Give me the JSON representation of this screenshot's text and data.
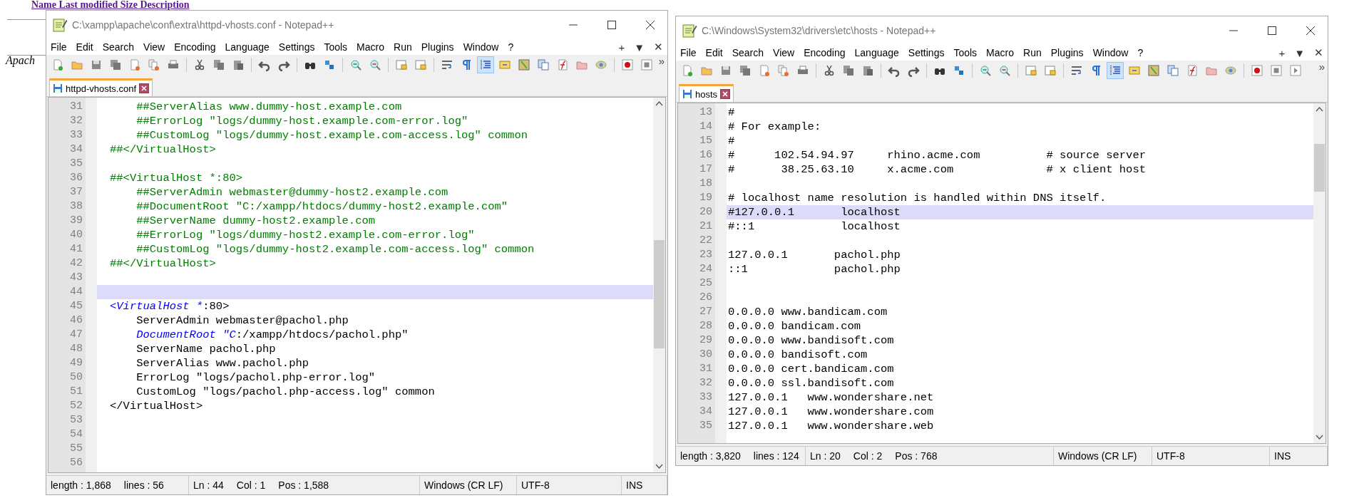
{
  "background_page": {
    "link": "Name Last modified Size Description",
    "footer": "Apach"
  },
  "windows": [
    {
      "title": "C:\\xampp\\apache\\conf\\extra\\httpd-vhosts.conf - Notepad++",
      "menu": [
        "File",
        "Edit",
        "Search",
        "View",
        "Encoding",
        "Language",
        "Settings",
        "Tools",
        "Macro",
        "Run",
        "Plugins",
        "Window",
        "?"
      ],
      "menu_controls": [
        "+",
        "▼",
        "✕"
      ],
      "toolbar": [
        {
          "kind": "new",
          "pressed": false
        },
        {
          "kind": "open",
          "pressed": false
        },
        {
          "kind": "save",
          "pressed": false
        },
        {
          "kind": "saveall",
          "pressed": false
        },
        {
          "kind": "close",
          "pressed": false
        },
        {
          "kind": "closeall",
          "pressed": false
        },
        {
          "kind": "print",
          "pressed": false
        },
        {
          "kind": "separator"
        },
        {
          "kind": "cut",
          "pressed": false
        },
        {
          "kind": "copy",
          "pressed": false
        },
        {
          "kind": "paste",
          "pressed": false
        },
        {
          "kind": "separator"
        },
        {
          "kind": "undo",
          "pressed": false
        },
        {
          "kind": "redo",
          "pressed": false
        },
        {
          "kind": "separator"
        },
        {
          "kind": "find",
          "pressed": false
        },
        {
          "kind": "replace",
          "pressed": false
        },
        {
          "kind": "separator"
        },
        {
          "kind": "zoomin",
          "pressed": false
        },
        {
          "kind": "zoomout",
          "pressed": false
        },
        {
          "kind": "separator"
        },
        {
          "kind": "syncv",
          "pressed": false
        },
        {
          "kind": "synch",
          "pressed": false
        },
        {
          "kind": "separator"
        },
        {
          "kind": "wrap",
          "pressed": false
        },
        {
          "kind": "allchars",
          "pressed": false
        },
        {
          "kind": "indent",
          "pressed": true
        },
        {
          "kind": "udl",
          "pressed": false
        },
        {
          "kind": "docmap",
          "pressed": false
        },
        {
          "kind": "doclist",
          "pressed": false
        },
        {
          "kind": "funclist",
          "pressed": false
        },
        {
          "kind": "folder",
          "pressed": false
        },
        {
          "kind": "monitor",
          "pressed": false
        },
        {
          "kind": "separator"
        },
        {
          "kind": "record",
          "pressed": false
        },
        {
          "kind": "stop",
          "pressed": false
        }
      ],
      "toolbar_overflow": "»",
      "tabs": [
        {
          "label": "httpd-vhosts.conf",
          "selected": true
        }
      ],
      "editor": {
        "lines": [
          {
            "number": "31",
            "selected": false,
            "segments": [
              {
                "text": "    ##ServerAlias www.dummy-host.example.com",
                "kind": "comment"
              }
            ]
          },
          {
            "number": "32",
            "selected": false,
            "segments": [
              {
                "text": "    ##ErrorLog \"logs/dummy-host.example.com-error.log\"",
                "kind": "comment"
              }
            ]
          },
          {
            "number": "33",
            "selected": false,
            "segments": [
              {
                "text": "    ##CustomLog \"logs/dummy-host.example.com-access.log\" common",
                "kind": "comment"
              }
            ]
          },
          {
            "number": "34",
            "selected": false,
            "segments": [
              {
                "text": "##</VirtualHost>",
                "kind": "comment"
              }
            ]
          },
          {
            "number": "35",
            "selected": false
          },
          {
            "number": "36",
            "selected": false,
            "segments": [
              {
                "text": "##<VirtualHost *:80>",
                "kind": "comment"
              }
            ]
          },
          {
            "number": "37",
            "selected": false,
            "segments": [
              {
                "text": "    ##ServerAdmin webmaster@dummy-host2.example.com",
                "kind": "comment"
              }
            ]
          },
          {
            "number": "38",
            "selected": false,
            "segments": [
              {
                "text": "    ##DocumentRoot \"C:/xampp/htdocs/dummy-host2.example.com\"",
                "kind": "comment"
              }
            ]
          },
          {
            "number": "39",
            "selected": false,
            "segments": [
              {
                "text": "    ##ServerName dummy-host2.example.com",
                "kind": "comment"
              }
            ]
          },
          {
            "number": "40",
            "selected": false,
            "segments": [
              {
                "text": "    ##ErrorLog \"logs/dummy-host2.example.com-error.log\"",
                "kind": "comment"
              }
            ]
          },
          {
            "number": "41",
            "selected": false,
            "segments": [
              {
                "text": "    ##CustomLog \"logs/dummy-host2.example.com-access.log\" common",
                "kind": "comment"
              }
            ]
          },
          {
            "number": "42",
            "selected": false,
            "segments": [
              {
                "text": "##</VirtualHost>",
                "kind": "comment"
              }
            ]
          },
          {
            "number": "43",
            "selected": false
          },
          {
            "number": "44",
            "selected": true
          },
          {
            "number": "45",
            "selected": false,
            "segments": [
              {
                "text": "<VirtualHost *",
                "kind": "keyword"
              },
              {
                "text": ":80>",
                "kind": "plain"
              }
            ]
          },
          {
            "number": "46",
            "selected": false,
            "segments": [
              {
                "text": "    ServerAdmin webmaster@pachol.php",
                "kind": "plain"
              }
            ]
          },
          {
            "number": "47",
            "selected": false,
            "segments": [
              {
                "text": "    DocumentRoot \"C",
                "kind": "keyword"
              },
              {
                "text": ":/xampp/htdocs/pachol.php\"",
                "kind": "plain"
              }
            ]
          },
          {
            "number": "48",
            "selected": false,
            "segments": [
              {
                "text": "    ServerName pachol.php",
                "kind": "plain"
              }
            ]
          },
          {
            "number": "49",
            "selected": false,
            "segments": [
              {
                "text": "    ServerAlias www.pachol.php",
                "kind": "plain"
              }
            ]
          },
          {
            "number": "50",
            "selected": false,
            "segments": [
              {
                "text": "    ErrorLog \"logs/pachol.php-error.log\"",
                "kind": "plain"
              }
            ]
          },
          {
            "number": "51",
            "selected": false,
            "segments": [
              {
                "text": "    CustomLog \"logs/pachol.php-access.log\" common",
                "kind": "plain"
              }
            ]
          },
          {
            "number": "52",
            "selected": false,
            "segments": [
              {
                "text": "</VirtualHost>",
                "kind": "plain"
              }
            ]
          },
          {
            "number": "53",
            "selected": false
          },
          {
            "number": "54",
            "selected": false
          },
          {
            "number": "55",
            "selected": false
          },
          {
            "number": "56",
            "selected": false
          }
        ]
      },
      "status_bar": [
        [
          "length : 1,868",
          "lines : 56"
        ],
        [
          "Ln : 44",
          "Col : 1",
          "Pos : 1,588"
        ],
        [
          "Windows (CR LF)"
        ],
        [
          "UTF-8"
        ],
        [
          "INS"
        ]
      ]
    },
    {
      "title": "C:\\Windows\\System32\\drivers\\etc\\hosts - Notepad++",
      "menu": [
        "File",
        "Edit",
        "Search",
        "View",
        "Encoding",
        "Language",
        "Settings",
        "Tools",
        "Macro",
        "Run",
        "Plugins",
        "Window",
        "?"
      ],
      "menu_controls": [
        "+",
        "▼",
        "✕"
      ],
      "toolbar": [
        {
          "kind": "new",
          "pressed": false
        },
        {
          "kind": "open",
          "pressed": false
        },
        {
          "kind": "save",
          "pressed": false
        },
        {
          "kind": "saveall",
          "pressed": false
        },
        {
          "kind": "close",
          "pressed": false
        },
        {
          "kind": "closeall",
          "pressed": false
        },
        {
          "kind": "print",
          "pressed": false
        },
        {
          "kind": "separator"
        },
        {
          "kind": "cut",
          "pressed": false
        },
        {
          "kind": "copy",
          "pressed": false
        },
        {
          "kind": "paste",
          "pressed": false
        },
        {
          "kind": "separator"
        },
        {
          "kind": "undo",
          "pressed": false
        },
        {
          "kind": "redo",
          "pressed": false
        },
        {
          "kind": "separator"
        },
        {
          "kind": "find",
          "pressed": false
        },
        {
          "kind": "replace",
          "pressed": false
        },
        {
          "kind": "separator"
        },
        {
          "kind": "zoomin",
          "pressed": false
        },
        {
          "kind": "zoomout",
          "pressed": false
        },
        {
          "kind": "separator"
        },
        {
          "kind": "syncv",
          "pressed": false
        },
        {
          "kind": "synch",
          "pressed": false
        },
        {
          "kind": "separator"
        },
        {
          "kind": "wrap",
          "pressed": false
        },
        {
          "kind": "allchars",
          "pressed": false
        },
        {
          "kind": "indent",
          "pressed": true
        },
        {
          "kind": "udl",
          "pressed": false
        },
        {
          "kind": "docmap",
          "pressed": false
        },
        {
          "kind": "doclist",
          "pressed": false
        },
        {
          "kind": "funclist",
          "pressed": false
        },
        {
          "kind": "folder",
          "pressed": false
        },
        {
          "kind": "monitor",
          "pressed": false
        },
        {
          "kind": "separator"
        },
        {
          "kind": "record",
          "pressed": false
        },
        {
          "kind": "stop",
          "pressed": false
        },
        {
          "kind": "play",
          "pressed": false
        }
      ],
      "toolbar_overflow": "»",
      "tabs": [
        {
          "label": "hosts",
          "selected": true
        }
      ],
      "editor": {
        "lines": [
          {
            "number": "13",
            "selected": false,
            "segments": [
              {
                "text": "#",
                "kind": "plain"
              }
            ]
          },
          {
            "number": "14",
            "selected": false,
            "segments": [
              {
                "text": "# For example:",
                "kind": "plain"
              }
            ]
          },
          {
            "number": "15",
            "selected": false,
            "segments": [
              {
                "text": "#",
                "kind": "plain"
              }
            ]
          },
          {
            "number": "16",
            "selected": false,
            "segments": [
              {
                "text": "#      102.54.94.97     rhino.acme.com          # source server",
                "kind": "plain"
              }
            ]
          },
          {
            "number": "17",
            "selected": false,
            "segments": [
              {
                "text": "#       38.25.63.10     x.acme.com              # x client host",
                "kind": "plain"
              }
            ]
          },
          {
            "number": "18",
            "selected": false
          },
          {
            "number": "19",
            "selected": false,
            "segments": [
              {
                "text": "# localhost name resolution is handled within DNS itself.",
                "kind": "plain"
              }
            ]
          },
          {
            "number": "20",
            "selected": true,
            "segments": [
              {
                "text": "#127.0.0.1       localhost",
                "kind": "plain"
              }
            ]
          },
          {
            "number": "21",
            "selected": false,
            "segments": [
              {
                "text": "#::1             localhost",
                "kind": "plain"
              }
            ]
          },
          {
            "number": "22",
            "selected": false
          },
          {
            "number": "23",
            "selected": false,
            "segments": [
              {
                "text": "127.0.0.1       pachol.php",
                "kind": "plain"
              }
            ]
          },
          {
            "number": "24",
            "selected": false,
            "segments": [
              {
                "text": "::1             pachol.php",
                "kind": "plain"
              }
            ]
          },
          {
            "number": "25",
            "selected": false
          },
          {
            "number": "26",
            "selected": false
          },
          {
            "number": "27",
            "selected": false,
            "segments": [
              {
                "text": "0.0.0.0 www.bandicam.com",
                "kind": "plain"
              }
            ]
          },
          {
            "number": "28",
            "selected": false,
            "segments": [
              {
                "text": "0.0.0.0 bandicam.com",
                "kind": "plain"
              }
            ]
          },
          {
            "number": "29",
            "selected": false,
            "segments": [
              {
                "text": "0.0.0.0 www.bandisoft.com",
                "kind": "plain"
              }
            ]
          },
          {
            "number": "30",
            "selected": false,
            "segments": [
              {
                "text": "0.0.0.0 bandisoft.com",
                "kind": "plain"
              }
            ]
          },
          {
            "number": "31",
            "selected": false,
            "segments": [
              {
                "text": "0.0.0.0 cert.bandicam.com",
                "kind": "plain"
              }
            ]
          },
          {
            "number": "32",
            "selected": false,
            "segments": [
              {
                "text": "0.0.0.0 ssl.bandisoft.com",
                "kind": "plain"
              }
            ]
          },
          {
            "number": "33",
            "selected": false,
            "segments": [
              {
                "text": "127.0.0.1   www.wondershare.net",
                "kind": "plain"
              }
            ]
          },
          {
            "number": "34",
            "selected": false,
            "segments": [
              {
                "text": "127.0.0.1   www.wondershare.com",
                "kind": "plain"
              }
            ]
          },
          {
            "number": "35",
            "selected": false,
            "segments": [
              {
                "text": "127.0.0.1   www.wondershare.web",
                "kind": "plain"
              }
            ]
          }
        ]
      },
      "status_bar": [
        [
          "length : 3,820",
          "lines : 124"
        ],
        [
          "Ln : 20",
          "Col : 2",
          "Pos : 768"
        ],
        [
          "Windows (CR LF)"
        ],
        [
          "UTF-8"
        ],
        [
          "INS"
        ]
      ]
    }
  ]
}
